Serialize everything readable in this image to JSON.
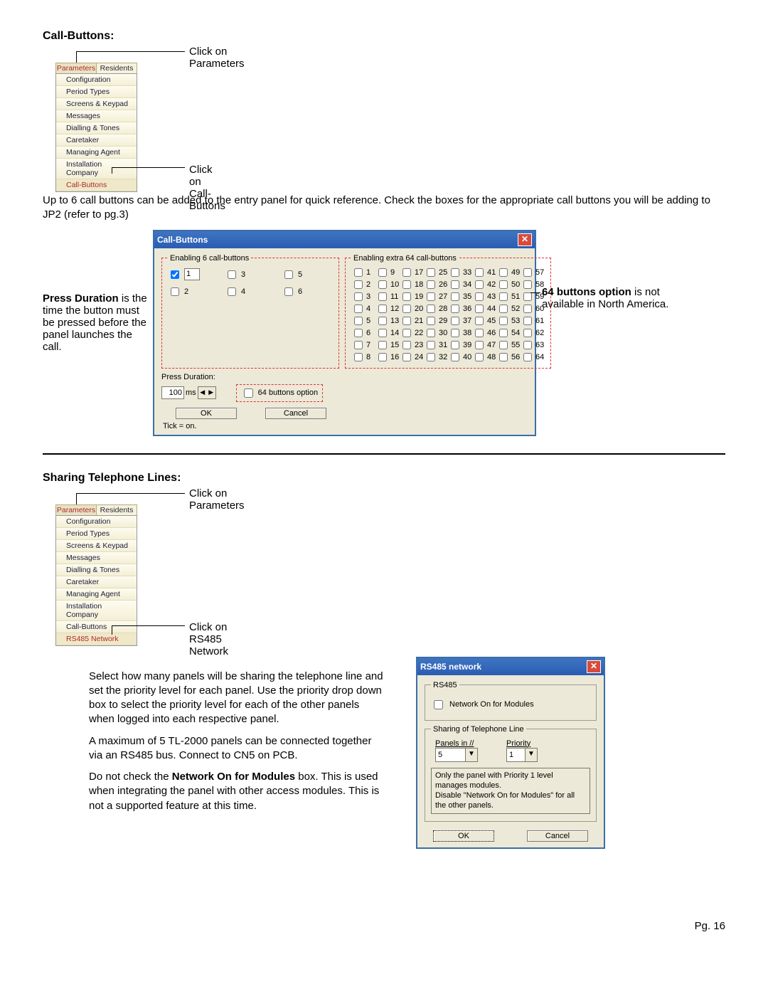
{
  "section1": {
    "title": "Call-Buttons:",
    "callout_top": "Click on Parameters",
    "callout_bottom": "Click on Call-Buttons",
    "tabs": {
      "parameters": "Parameters",
      "residents": "Residents"
    },
    "menu": [
      "Configuration",
      "Period Types",
      "Screens & Keypad",
      "Messages",
      "Dialling & Tones",
      "Caretaker",
      "Managing Agent",
      "Installation Company",
      "Call-Buttons"
    ],
    "intro": "Up to 6 call buttons can be added to the entry panel for quick reference.  Check the boxes for the appropriate call buttons you will be adding to JP2 (refer to pg.3)",
    "left_caption_bold": "Press Duration",
    "left_caption_rest": " is the time the button must be pressed before the panel launches the call.",
    "right_caption_bold": "64 buttons option",
    "right_caption_rest": " is not available in North America."
  },
  "cbdialog": {
    "title": "Call-Buttons",
    "fs6": "Enabling 6 call-buttons",
    "fs64": "Enabling extra 64 call-buttons",
    "press_duration_label": "Press Duration:",
    "press_duration_value": "100",
    "ms": "ms",
    "opt64": "64 buttons option",
    "ok": "OK",
    "cancel": "Cancel",
    "tick": "Tick = on."
  },
  "section2": {
    "title": "Sharing Telephone Lines:",
    "callout_top": "Click on Parameters",
    "callout_bottom": "Click on RS485 Network",
    "menu": [
      "Configuration",
      "Period Types",
      "Screens & Keypad",
      "Messages",
      "Dialling & Tones",
      "Caretaker",
      "Managing Agent",
      "Installation Company",
      "Call-Buttons",
      "RS485 Network"
    ],
    "para1": "Select how many panels will be sharing the telephone line and set the priority level for each panel.  Use the priority drop down box to select the priority level for each of the other panels when logged into each respective panel.",
    "para2": "A maximum of 5 TL-2000 panels can be connected together via an RS485 bus.  Connect to CN5 on PCB.",
    "para3a": "Do not check the ",
    "para3b": "Network On for Modules",
    "para3c": " box. This is used when integrating the panel with other access modules.  This is not a supported feature at this time."
  },
  "rsdialog": {
    "title": "RS485 network",
    "fs_rs485": "RS485",
    "network_on": "Network On for Modules",
    "fs_share": "Sharing of Telephone Line",
    "panels_label": "Panels in //",
    "priority_label": "Priority",
    "panels_value": "5",
    "priority_value": "1",
    "note": "Only the panel with Priority 1 level manages modules.\nDisable \"Network On for Modules\" for all the other panels.",
    "ok": "OK",
    "cancel": "Cancel"
  },
  "footer": {
    "page": "Pg. 16"
  }
}
